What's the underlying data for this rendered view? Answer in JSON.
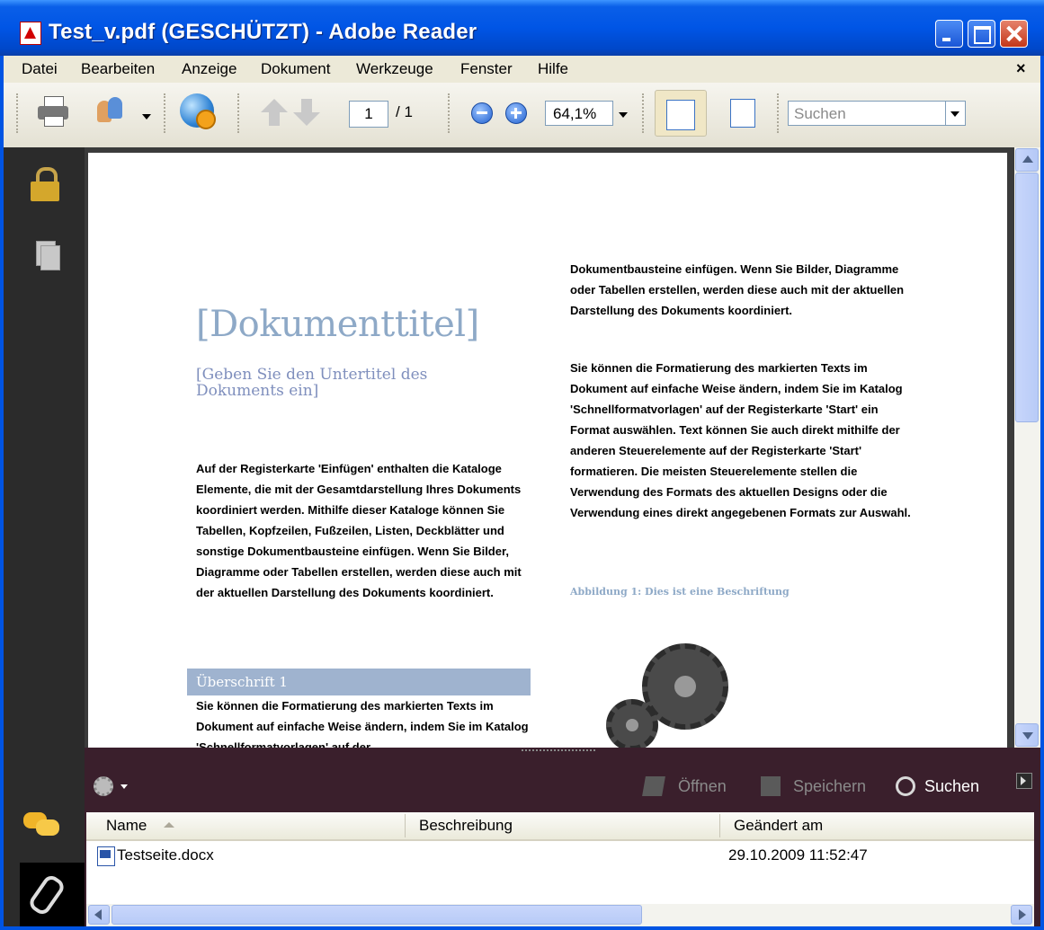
{
  "window": {
    "title": "Test_v.pdf (GESCHÜTZT) - Adobe Reader"
  },
  "menu": {
    "items": [
      "Datei",
      "Bearbeiten",
      "Anzeige",
      "Dokument",
      "Werkzeuge",
      "Fenster",
      "Hilfe"
    ],
    "close_glyph": "×"
  },
  "toolbar": {
    "page_current": "1",
    "page_total": "/ 1",
    "zoom": "64,1%",
    "search_placeholder": "Suchen",
    "icons": [
      "printer-icon",
      "collaborate-icon",
      "secure-globe-icon",
      "previous-page-icon",
      "next-page-icon",
      "zoom-out-icon",
      "zoom-in-icon",
      "fit-width-icon",
      "fit-page-icon"
    ]
  },
  "document": {
    "title": "[Dokumenttitel]",
    "subtitle": "[Geben Sie den Untertitel des Dokuments ein]",
    "left_paragraph": "Auf der Registerkarte 'Einfügen' enthalten die Kataloge Elemente, die mit der Gesamtdarstellung Ihres Dokuments koordiniert werden. Mithilfe dieser Kataloge können Sie Tabellen, Kopfzeilen, Fußzeilen, Listen, Deckblätter und sonstige Dokumentbausteine einfügen. Wenn Sie Bilder, Diagramme oder Tabellen erstellen, werden diese auch mit der aktuellen Darstellung des Dokuments koordiniert.",
    "heading1": "Überschrift 1",
    "left_paragraph2": "Sie können die Formatierung des markierten Texts im Dokument auf einfache Weise ändern, indem Sie im Katalog 'Schnellformatvorlagen' auf der",
    "right_paragraph1": "Dokumentbausteine einfügen. Wenn Sie Bilder, Diagramme oder Tabellen erstellen, werden diese auch mit der aktuellen Darstellung des Dokuments koordiniert.",
    "right_paragraph2": "Sie können die Formatierung des markierten Texts im Dokument auf einfache Weise ändern, indem Sie im Katalog 'Schnellformatvorlagen' auf der Registerkarte 'Start' ein Format auswählen. Text können Sie auch direkt mithilfe der anderen Steuerelemente auf der Registerkarte 'Start' formatieren. Die meisten Steuerelemente stellen die Verwendung des Formats des aktuellen Designs oder die Verwendung eines direkt angegebenen Formats zur Auswahl.",
    "caption": "Abbildung 1: Dies ist eine Beschriftung"
  },
  "attachments": {
    "actions": {
      "open": "Öffnen",
      "save": "Speichern",
      "search": "Suchen"
    },
    "columns": {
      "name": "Name",
      "description": "Beschreibung",
      "modified": "Geändert am"
    },
    "rows": [
      {
        "name": "Testseite.docx",
        "description": "",
        "modified": "29.10.2009 11:52:47"
      }
    ]
  },
  "colors": {
    "titlebar": "#0055e5",
    "doc_title": "#8ea9c7",
    "heading_band": "#9fb3cf",
    "panel_bg": "#3a1f2c"
  }
}
